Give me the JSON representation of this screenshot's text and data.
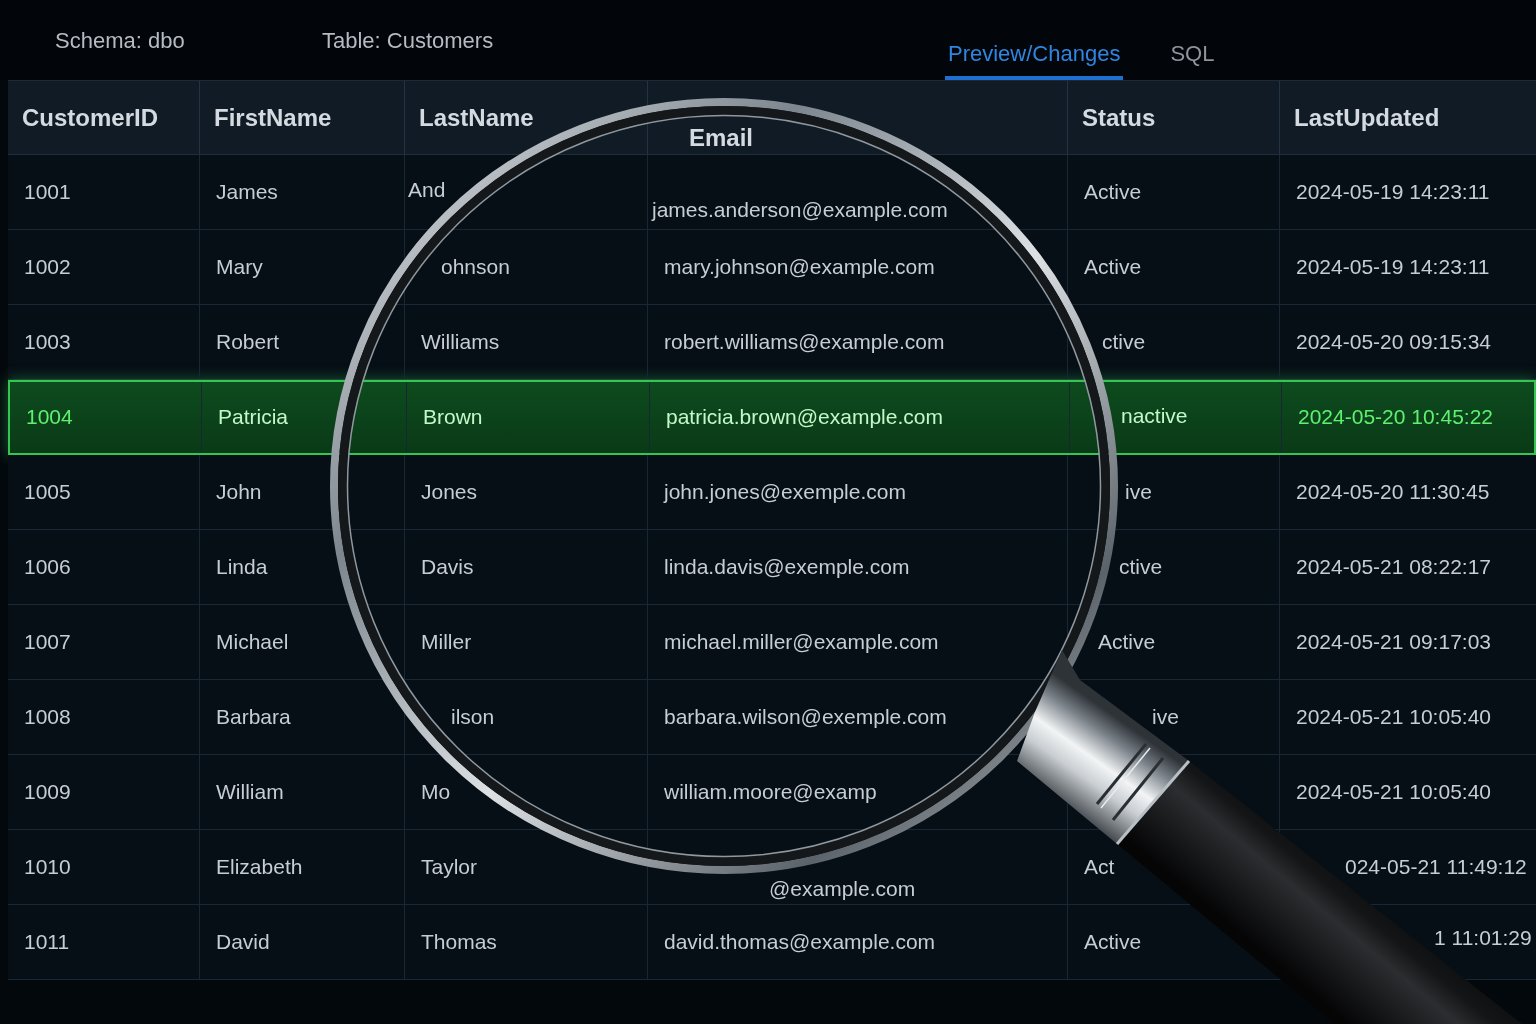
{
  "toolbar": {
    "schema_label": "Schema: dbo",
    "table_label": "Table: Customers"
  },
  "tabs": [
    {
      "label": "Preview/Changes",
      "selected": true
    },
    {
      "label": "SQL",
      "selected": false
    }
  ],
  "table": {
    "columns": [
      "CustomerID",
      "FirstName",
      "LastName",
      "Email",
      "Status",
      "LastUpdated"
    ],
    "rows": [
      {
        "selected": false,
        "cells": [
          "1001",
          "James",
          "And",
          "james.anderson@example.com",
          "Active",
          "2024-05-19 14:23:11"
        ]
      },
      {
        "selected": false,
        "cells": [
          "1002",
          "Mary",
          "ohnson",
          "mary.johnson@example.com",
          "Active",
          "2024-05-19 14:23:11"
        ]
      },
      {
        "selected": false,
        "cells": [
          "1003",
          "Robert",
          "Williams",
          "robert.williams@example.com",
          "ctive",
          "2024-05-20 09:15:34"
        ]
      },
      {
        "selected": true,
        "cells": [
          "1004",
          "Patricia",
          "Brown",
          "patricia.brown@example.com",
          "nactive",
          "2024-05-20 10:45:22"
        ]
      },
      {
        "selected": false,
        "cells": [
          "1005",
          "John",
          "Jones",
          "john.jones@exemple.com",
          "ive",
          "2024-05-20 11:30:45"
        ]
      },
      {
        "selected": false,
        "cells": [
          "1006",
          "Linda",
          "Davis",
          "linda.davis@exemple.com",
          "ctive",
          "2024-05-21 08:22:17"
        ]
      },
      {
        "selected": false,
        "cells": [
          "1007",
          "Michael",
          "Miller",
          "michael.miller@example.com",
          "Active",
          "2024-05-21 09:17:03"
        ]
      },
      {
        "selected": false,
        "cells": [
          "1008",
          "Barbara",
          "ilson",
          "barbara.wilson@exemple.com",
          "ive",
          "2024-05-21 10:05:40"
        ]
      },
      {
        "selected": false,
        "cells": [
          "1009",
          "William",
          "Mo",
          "william.moore@examp",
          null,
          "2024-05-21 10:05:40"
        ]
      },
      {
        "selected": false,
        "cells": [
          "1010",
          "Elizabeth",
          "Taylor",
          "@example.com",
          "Act",
          "024-05-21 11:49:12"
        ]
      },
      {
        "selected": false,
        "cells": [
          "1011",
          "David",
          "Thomas",
          "david.thomas@example.com",
          "Active",
          "1 11:01:29"
        ]
      }
    ]
  }
}
